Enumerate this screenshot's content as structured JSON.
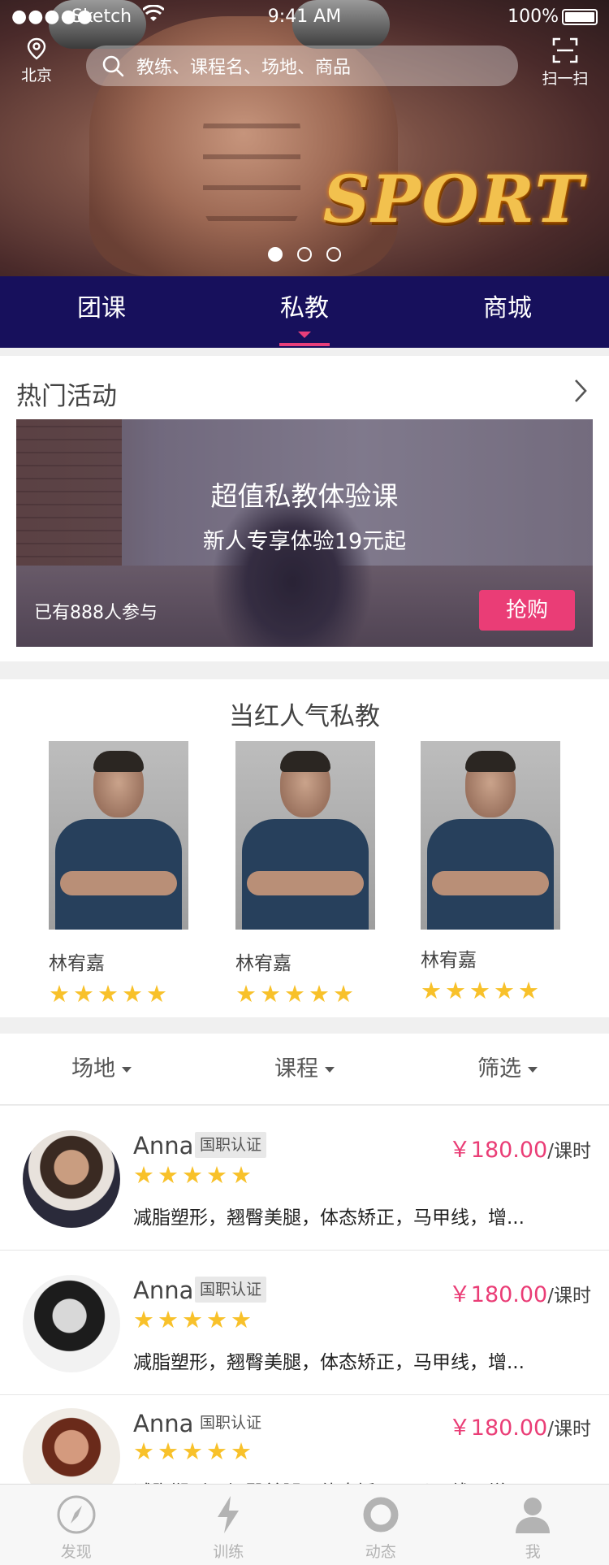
{
  "status_bar": {
    "signal_dots": "●●●●●",
    "carrier": "Sketch",
    "time": "9:41 AM",
    "battery": "100%"
  },
  "hero": {
    "location": "北京",
    "search_placeholder": "教练、课程名、场地、商品",
    "scan_label": "扫一扫",
    "sport_text": "SPORT",
    "carousel_pages": 3,
    "carousel_active": 1
  },
  "tabs": [
    {
      "label": "团课"
    },
    {
      "label": "私教",
      "active": true
    },
    {
      "label": "商城"
    }
  ],
  "activity": {
    "title": "热门活动",
    "banner_title": "超值私教体验课",
    "banner_subtitle": "新人专享体验19元起",
    "participants": "已有888人参与",
    "buy_label": "抢购"
  },
  "trainers": {
    "title": "当红人气私教",
    "items": [
      {
        "name": "林宥嘉",
        "stars": "★★★★★"
      },
      {
        "name": "林宥嘉",
        "stars": "★★★★★"
      },
      {
        "name": "林宥嘉",
        "stars": "★★★★★"
      }
    ]
  },
  "filters": [
    {
      "label": "场地"
    },
    {
      "label": "课程"
    },
    {
      "label": "筛选"
    }
  ],
  "coaches": [
    {
      "name": "Anna",
      "cert": "国职认证",
      "price": "￥180.00",
      "unit": "/课时",
      "stars": "★★★★★",
      "tags": "减脂塑形，翘臀美腿，体态矫正，马甲线，增..."
    },
    {
      "name": "Anna",
      "cert": "国职认证",
      "price": "￥180.00",
      "unit": "/课时",
      "stars": "★★★★★",
      "tags": "减脂塑形，翘臀美腿，体态矫正，马甲线，增..."
    },
    {
      "name": "Anna",
      "cert": "国职认证",
      "price": "￥180.00",
      "unit": "/课时",
      "stars": "★★★★★",
      "tags": "减脂塑形，翘臀美腿，体态矫正，马甲线，增..."
    }
  ],
  "bottom_nav": [
    {
      "label": "发现",
      "icon": "compass-icon"
    },
    {
      "label": "训练",
      "icon": "lightning-icon"
    },
    {
      "label": "动态",
      "icon": "ring-icon"
    },
    {
      "label": "我",
      "icon": "user-icon"
    }
  ],
  "colors": {
    "tab_bar": "#17105c",
    "accent": "#ea3d76",
    "star": "#f8c12a"
  }
}
